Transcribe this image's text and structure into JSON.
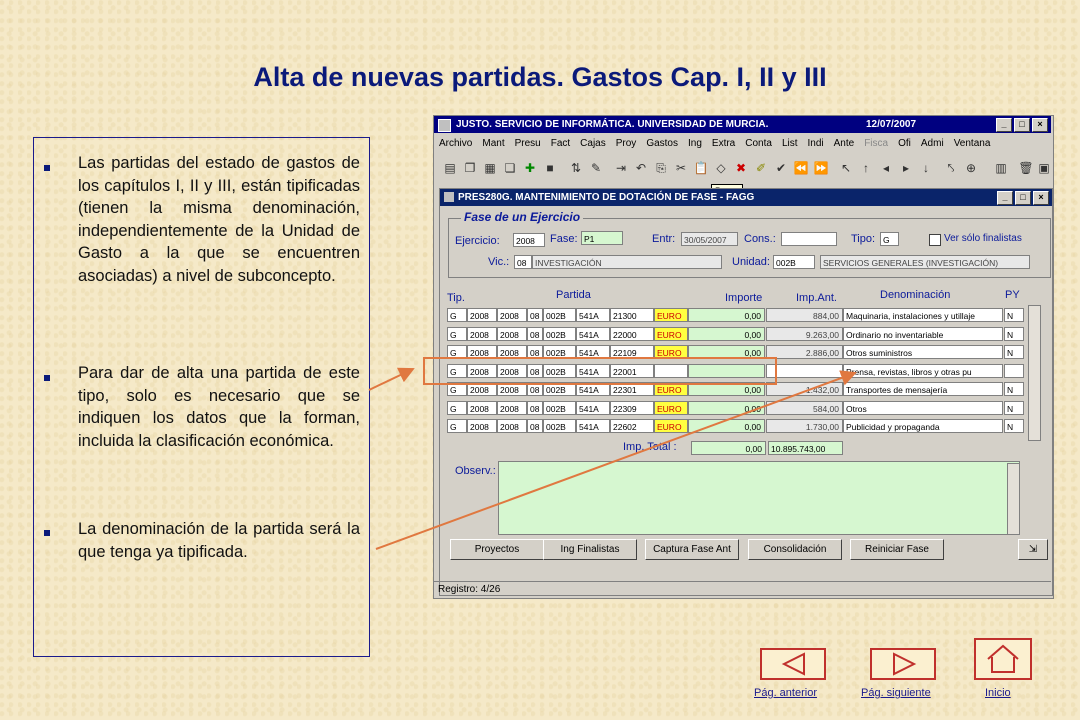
{
  "slide": {
    "title": "Alta de nuevas partidas. Gastos Cap. I, II y III",
    "bullets": [
      "Las partidas del estado de gastos de los capítulos I, II y III, están tipificadas (tienen la misma denominación, independientemente de la Unidad de Gasto a la que se encuentren asociadas) a nivel de subconcepto.",
      "Para dar de alta una partida de este tipo, solo es necesario que se indiquen los datos que la forman, incluida la clasificación económica.",
      "La denominación de la partida será la que tenga ya tipificada."
    ]
  },
  "app": {
    "window_title": "JUSTO. SERVICIO DE INFORMÁTICA. UNIVERSIDAD DE MURCIA.",
    "date": "12/07/2007",
    "menu": [
      "Archivo",
      "Mant",
      "Presu",
      "Fact",
      "Cajas",
      "Proy",
      "Gastos",
      "Ing",
      "Extra",
      "Conta",
      "List",
      "Indi",
      "Ante",
      "Fisca",
      "Ofi",
      "Admi",
      "Ventana"
    ],
    "tooltip": "Pegar",
    "inner_title": "PRES280G. MANTENIMIENTO DE DOTACIÓN DE FASE - FAGG",
    "group_title": "Fase de un Ejercicio",
    "form": {
      "ejercicio_label": "Ejercicio:",
      "ejercicio": "2008",
      "fase_label": "Fase:",
      "fase": "P1",
      "entr_label": "Entr:",
      "entr": "30/05/2007",
      "cons_label": "Cons.:",
      "cons": "",
      "tipo_label": "Tipo:",
      "tipo": "G",
      "finalistas_label": "Ver sólo finalistas",
      "vic_label": "Vic.:",
      "vic_code": "08",
      "vic_name": "INVESTIGACIÓN",
      "unidad_label": "Unidad:",
      "unidad_code": "002B",
      "unidad_name": "SERVICIOS GENERALES (INVESTIGACIÓN)"
    },
    "columns": {
      "tip": "Tip.",
      "partida": "Partida",
      "importe": "Importe",
      "imp_ant": "Imp.Ant.",
      "denominacion": "Denominación",
      "py": "PY"
    },
    "rows": [
      {
        "tip": "G",
        "a": "2008",
        "b": "2008",
        "c": "08",
        "d": "002B",
        "e": "541A",
        "f": "21300",
        "mon": "EURO",
        "imp": "0,00",
        "ant": "884,00",
        "den": "Maquinaria, instalaciones y utillaje",
        "py": "N"
      },
      {
        "tip": "G",
        "a": "2008",
        "b": "2008",
        "c": "08",
        "d": "002B",
        "e": "541A",
        "f": "22000",
        "mon": "EURO",
        "imp": "0,00",
        "ant": "9.263,00",
        "den": "Ordinario no inventariable",
        "py": "N"
      },
      {
        "tip": "G",
        "a": "2008",
        "b": "2008",
        "c": "08",
        "d": "002B",
        "e": "541A",
        "f": "22109",
        "mon": "EURO",
        "imp": "0,00",
        "ant": "2.886,00",
        "den": "Otros suministros",
        "py": "N"
      },
      {
        "tip": "G",
        "a": "2008",
        "b": "2008",
        "c": "08",
        "d": "002B",
        "e": "541A",
        "f": "22001",
        "mon": "",
        "imp": "",
        "ant": "",
        "den": "Prensa, revistas, libros y otras pu",
        "py": ""
      },
      {
        "tip": "G",
        "a": "2008",
        "b": "2008",
        "c": "08",
        "d": "002B",
        "e": "541A",
        "f": "22301",
        "mon": "EURO",
        "imp": "0,00",
        "ant": "1.432,00",
        "den": "Transportes de mensajería",
        "py": "N"
      },
      {
        "tip": "G",
        "a": "2008",
        "b": "2008",
        "c": "08",
        "d": "002B",
        "e": "541A",
        "f": "22309",
        "mon": "EURO",
        "imp": "0,00",
        "ant": "584,00",
        "den": "Otros",
        "py": "N"
      },
      {
        "tip": "G",
        "a": "2008",
        "b": "2008",
        "c": "08",
        "d": "002B",
        "e": "541A",
        "f": "22602",
        "mon": "EURO",
        "imp": "0,00",
        "ant": "1.730,00",
        "den": "Publicidad y propaganda",
        "py": "N"
      }
    ],
    "total_label": "Imp. Total :",
    "total_imp": "0,00",
    "total_ant": "10.895.743,00",
    "observ_label": "Observ.:",
    "buttons": [
      "Proyectos",
      "Ing Finalistas",
      "Captura Fase Ant",
      "Consolidación",
      "Reiniciar Fase"
    ],
    "status": "Registro: 4/26"
  },
  "nav": {
    "prev": "Pág. anterior",
    "next": "Pág. siguiente",
    "home": "Inicio"
  },
  "colors": {
    "title": "#0b1a7a",
    "highlight": "#e07840",
    "nav_border": "#c0302c"
  }
}
